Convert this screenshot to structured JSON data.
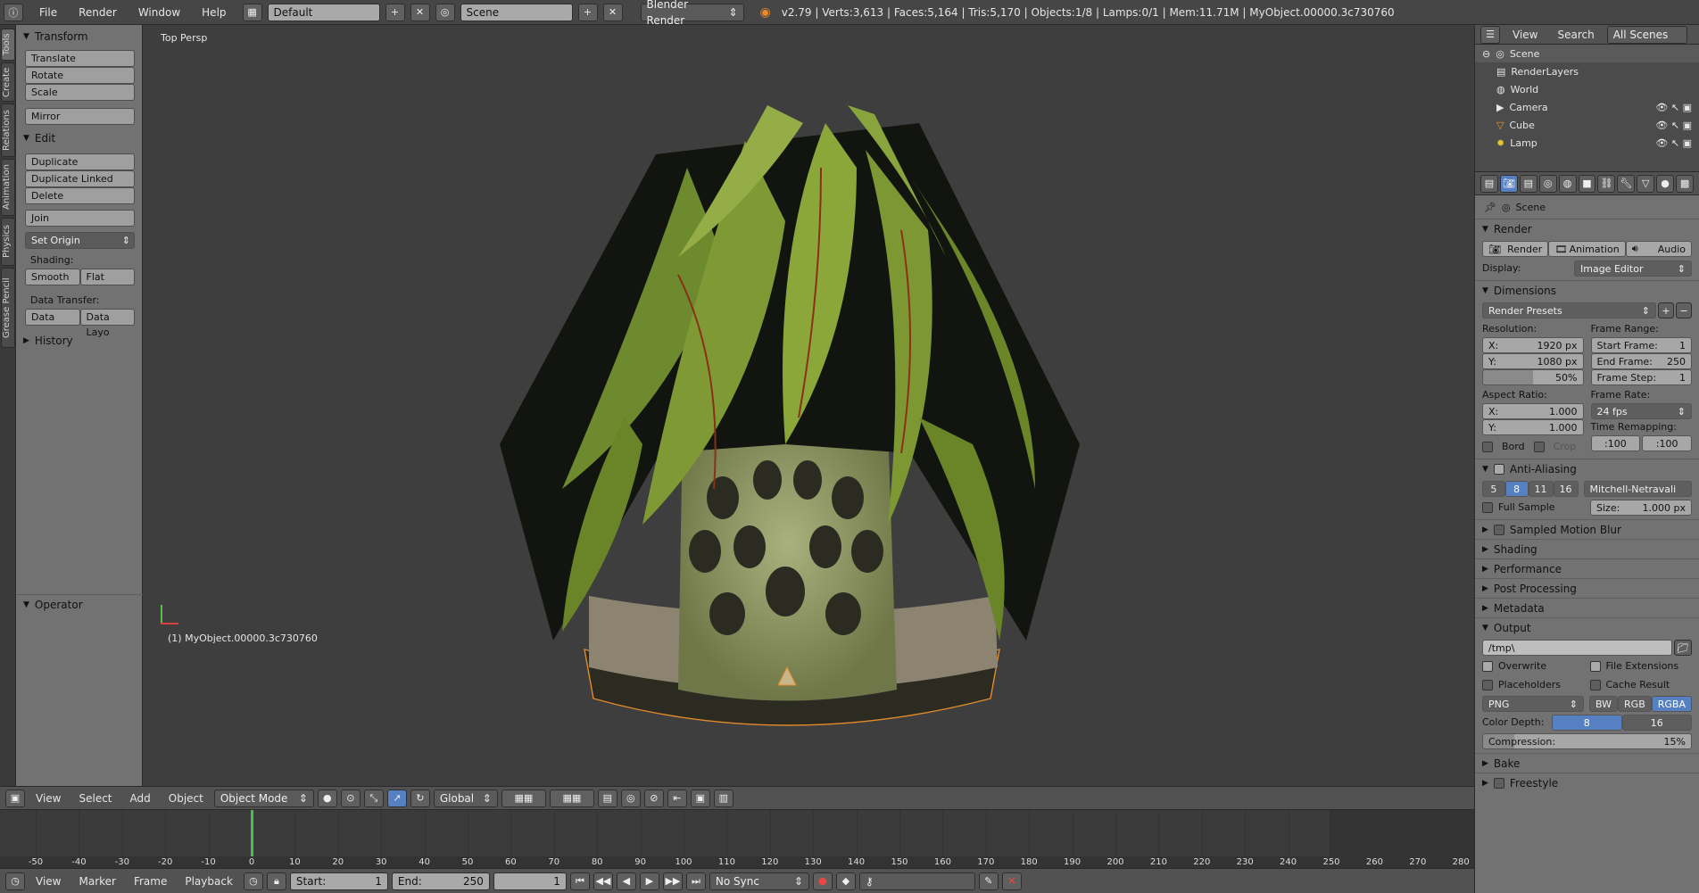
{
  "topbar": {
    "menus": [
      "File",
      "Render",
      "Window",
      "Help"
    ],
    "layout": "Default",
    "scene": "Scene",
    "engine": "Blender Render",
    "stats": "v2.79 | Verts:3,613 | Faces:5,164 | Tris:5,170 | Objects:1/8 | Lamps:0/1 | Mem:11.71M | MyObject.00000.3c730760"
  },
  "tabs": [
    "Tools",
    "Create",
    "Relations",
    "Animation",
    "Physics",
    "Grease Pencil"
  ],
  "toolshelf": {
    "transform": "Transform",
    "translate": "Translate",
    "rotate": "Rotate",
    "scale": "Scale",
    "mirror": "Mirror",
    "edit": "Edit",
    "duplicate": "Duplicate",
    "duplicate_linked": "Duplicate Linked",
    "delete": "Delete",
    "join": "Join",
    "set_origin": "Set Origin",
    "shading": "Shading:",
    "smooth": "Smooth",
    "flat": "Flat",
    "data_transfer": "Data Transfer:",
    "data": "Data",
    "data_layo": "Data Layo",
    "history": "History",
    "operator": "Operator"
  },
  "viewport": {
    "view_name": "Top Persp",
    "object_label": "(1) MyObject.00000.3c730760"
  },
  "vp_header": {
    "menus": [
      "View",
      "Select",
      "Add",
      "Object"
    ],
    "mode": "Object Mode",
    "orientation": "Global"
  },
  "timeline": {
    "ticks": [
      "-50",
      "-40",
      "-30",
      "-20",
      "-10",
      "0",
      "10",
      "20",
      "30",
      "40",
      "50",
      "60",
      "70",
      "80",
      "90",
      "100",
      "110",
      "120",
      "130",
      "140",
      "150",
      "160",
      "170",
      "180",
      "190",
      "200",
      "210",
      "220",
      "230",
      "240",
      "250",
      "260",
      "270",
      "280"
    ],
    "current_frame_pct": 0.0
  },
  "tl_footer": {
    "menus": [
      "View",
      "Marker",
      "Frame",
      "Playback"
    ],
    "start_label": "Start:",
    "start": "1",
    "end_label": "End:",
    "end": "250",
    "current": "1",
    "sync": "No Sync"
  },
  "outliner": {
    "view": "View",
    "search": "Search",
    "scope": "All Scenes",
    "items": [
      "Scene",
      "RenderLayers",
      "World",
      "Camera",
      "Cube",
      "Lamp"
    ]
  },
  "props": {
    "scene": "Scene",
    "render_section": "Render",
    "render_btn": "Render",
    "animation_btn": "Animation",
    "audio_btn": "Audio",
    "display_label": "Display:",
    "display": "Image Editor",
    "dimensions": "Dimensions",
    "render_presets": "Render Presets",
    "resolution": "Resolution:",
    "res_x": "1920 px",
    "res_y": "1080 px",
    "res_pct": "50%",
    "frame_range": "Frame Range:",
    "start_frame": "Start Frame:",
    "start_frame_v": "1",
    "end_frame": "End Frame:",
    "end_frame_v": "250",
    "frame_step": "Frame Step:",
    "frame_step_v": "1",
    "aspect_ratio": "Aspect Ratio:",
    "asp_x": "1.000",
    "asp_y": "1.000",
    "frame_rate": "Frame Rate:",
    "fps": "24 fps",
    "time_remap": "Time Remapping:",
    "remap_old": ":100",
    "remap_new": ":100",
    "bord": "Bord",
    "crop": "Crop",
    "anti_aliasing": "Anti-Aliasing",
    "aa_samples": [
      "5",
      "8",
      "11",
      "16"
    ],
    "aa_filter": "Mitchell-Netravali",
    "full_sample": "Full Sample",
    "size_label": "Size:",
    "size": "1.000 px",
    "sampled_motion_blur": "Sampled Motion Blur",
    "shading": "Shading",
    "performance": "Performance",
    "post_processing": "Post Processing",
    "metadata": "Metadata",
    "output": "Output",
    "output_path": "/tmp\\",
    "overwrite": "Overwrite",
    "file_extensions": "File Extensions",
    "placeholders": "Placeholders",
    "cache_result": "Cache Result",
    "format": "PNG",
    "bw": "BW",
    "rgb": "RGB",
    "rgba": "RGBA",
    "color_depth": "Color Depth:",
    "depth_8": "8",
    "depth_16": "16",
    "compression": "Compression:",
    "compression_v": "15%",
    "bake": "Bake",
    "freestyle": "Freestyle"
  }
}
